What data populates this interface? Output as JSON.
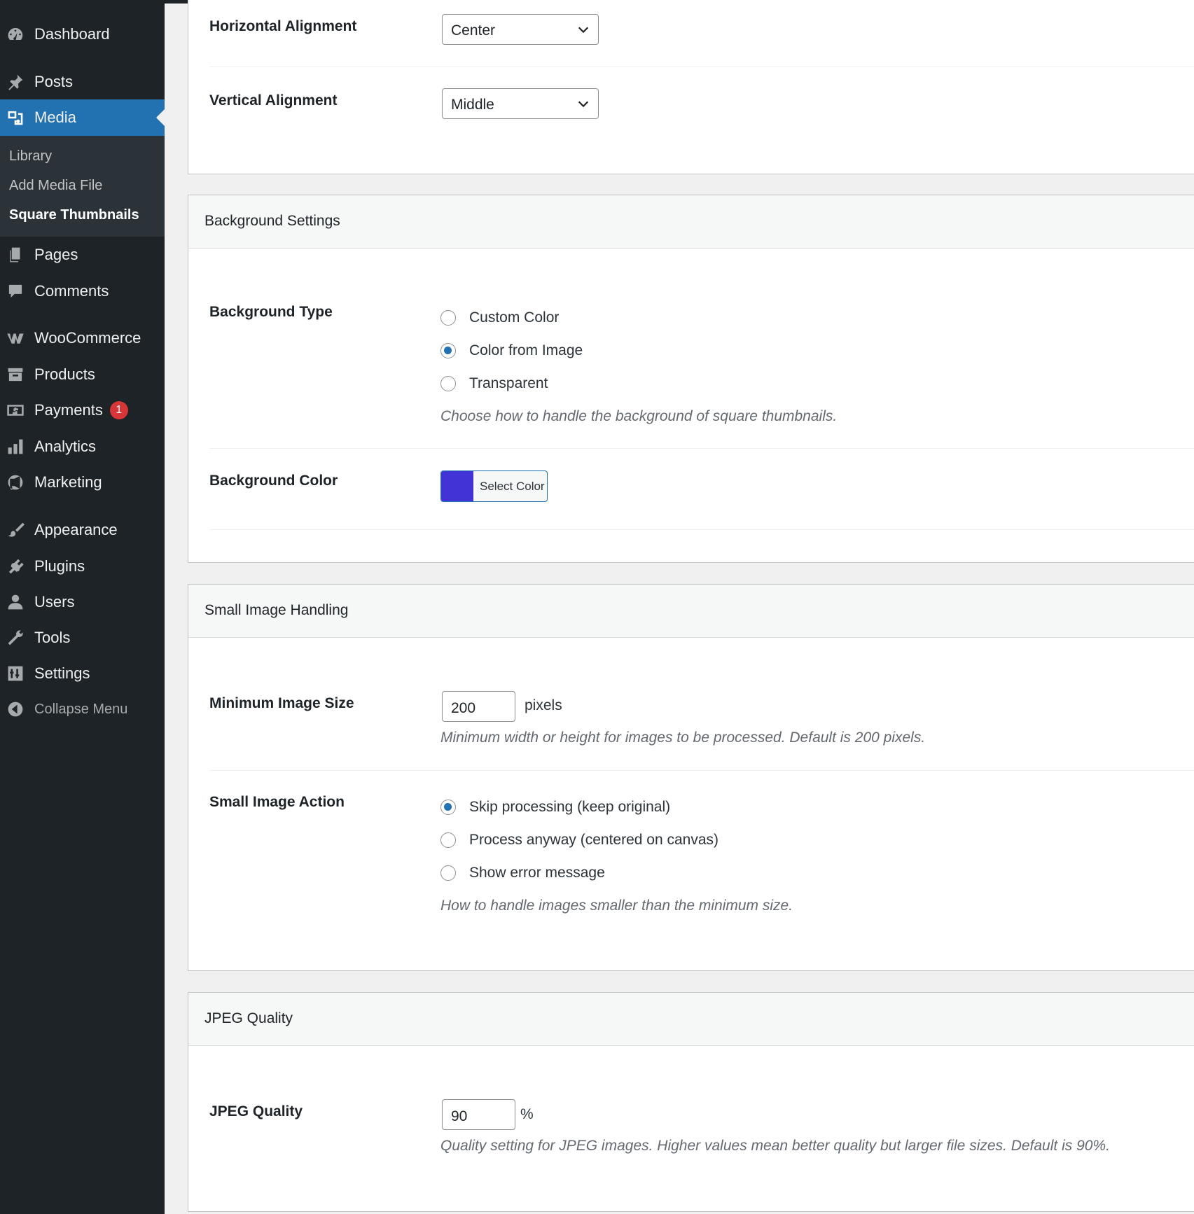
{
  "sidebar": {
    "items": [
      {
        "key": "dashboard",
        "label": "Dashboard"
      },
      {
        "key": "posts",
        "label": "Posts"
      },
      {
        "key": "media",
        "label": "Media"
      },
      {
        "key": "pages",
        "label": "Pages"
      },
      {
        "key": "comments",
        "label": "Comments"
      },
      {
        "key": "woocommerce",
        "label": "WooCommerce"
      },
      {
        "key": "products",
        "label": "Products"
      },
      {
        "key": "payments",
        "label": "Payments",
        "badge": "1"
      },
      {
        "key": "analytics",
        "label": "Analytics"
      },
      {
        "key": "marketing",
        "label": "Marketing"
      },
      {
        "key": "appearance",
        "label": "Appearance"
      },
      {
        "key": "plugins",
        "label": "Plugins"
      },
      {
        "key": "users",
        "label": "Users"
      },
      {
        "key": "tools",
        "label": "Tools"
      },
      {
        "key": "settings",
        "label": "Settings"
      }
    ],
    "submenu": [
      "Library",
      "Add Media File",
      "Square Thumbnails"
    ],
    "collapse_label": "Collapse Menu",
    "active_item": "Media",
    "current_submenu": "Square Thumbnails"
  },
  "alignment": {
    "horizontal_label": "Horizontal Alignment",
    "horizontal_value": "Center",
    "vertical_label": "Vertical Alignment",
    "vertical_value": "Middle"
  },
  "background": {
    "section_title": "Background Settings",
    "type_label": "Background Type",
    "options": [
      "Custom Color",
      "Color from Image",
      "Transparent"
    ],
    "selected_option": "Color from Image",
    "type_desc": "Choose how to handle the background of square thumbnails.",
    "color_label": "Background Color",
    "color_button": "Select Color",
    "color_value": "#4233d6"
  },
  "small_image": {
    "section_title": "Small Image Handling",
    "min_size_label": "Minimum Image Size",
    "min_size_value": "200",
    "min_size_unit": "pixels",
    "min_size_desc": "Minimum width or height for images to be processed. Default is 200 pixels.",
    "action_label": "Small Image Action",
    "options": [
      "Skip processing (keep original)",
      "Process anyway (centered on canvas)",
      "Show error message"
    ],
    "selected_option": "Skip processing (keep original)",
    "action_desc": "How to handle images smaller than the minimum size."
  },
  "jpeg": {
    "section_title": "JPEG Quality",
    "quality_label": "JPEG Quality",
    "quality_value": "90",
    "quality_unit": "%",
    "quality_desc": "Quality setting for JPEG images. Higher values mean better quality but larger file sizes. Default is 90%."
  },
  "colors": {
    "sidebar_bg": "#1d2327",
    "accent": "#2271b1",
    "badge": "#d63638"
  }
}
